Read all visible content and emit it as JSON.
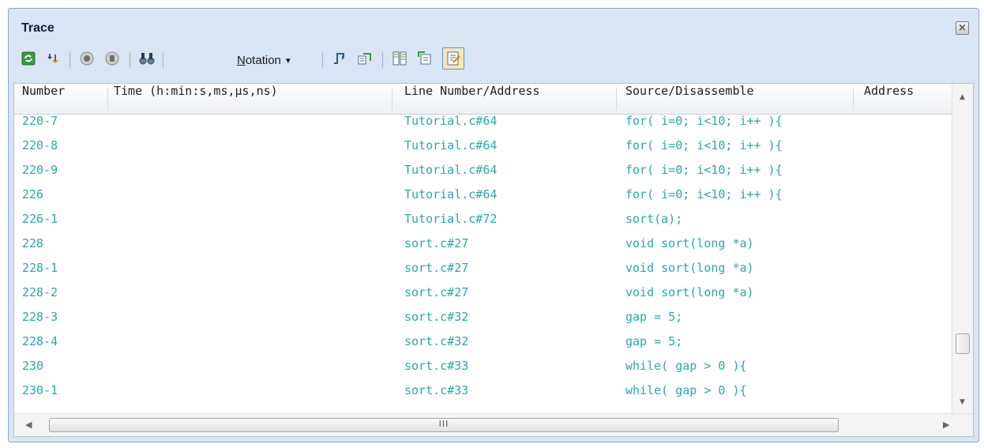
{
  "window": {
    "title": "Trace",
    "close_icon": "close-icon"
  },
  "toolbar": {
    "notation_label": "Notation",
    "notation_mnemonic": "N",
    "notation_rest": "otation",
    "icons": [
      "refresh-icon",
      "step-filter-icon",
      "record-start-icon",
      "record-stop-icon",
      "find-icon",
      "go-to-source-icon",
      "go-to-disassemble-icon",
      "mixed-display-icon",
      "link-to-source-icon",
      "source-disassemble-toggle-icon"
    ]
  },
  "table": {
    "columns": [
      "Number",
      "Time (h:min:s,ms,µs,ns)",
      "Line Number/Address",
      "Source/Disassemble",
      "Address"
    ],
    "rows": [
      {
        "number": "220-7",
        "time": "",
        "line": "Tutorial.c#64",
        "source": "for( i=0; i<10; i++ ){"
      },
      {
        "number": "220-8",
        "time": "",
        "line": "Tutorial.c#64",
        "source": "for( i=0; i<10; i++ ){"
      },
      {
        "number": "220-9",
        "time": "",
        "line": "Tutorial.c#64",
        "source": "for( i=0; i<10; i++ ){"
      },
      {
        "number": "226",
        "time": "",
        "line": "Tutorial.c#64",
        "source": "for( i=0; i<10; i++ ){"
      },
      {
        "number": "226-1",
        "time": "",
        "line": "Tutorial.c#72",
        "source": "sort(a);"
      },
      {
        "number": "228",
        "time": "",
        "line": "sort.c#27",
        "source": "void sort(long *a)"
      },
      {
        "number": "228-1",
        "time": "",
        "line": "sort.c#27",
        "source": "void sort(long *a)"
      },
      {
        "number": "228-2",
        "time": "",
        "line": "sort.c#27",
        "source": "void sort(long *a)"
      },
      {
        "number": "228-3",
        "time": "",
        "line": "sort.c#32",
        "source": "gap = 5;"
      },
      {
        "number": "228-4",
        "time": "",
        "line": "sort.c#32",
        "source": "gap = 5;"
      },
      {
        "number": "230",
        "time": "",
        "line": "sort.c#33",
        "source": "while( gap > 0 ){"
      },
      {
        "number": "230-1",
        "time": "",
        "line": "sort.c#33",
        "source": "while( gap > 0 ){"
      }
    ]
  },
  "scrollbar": {
    "thumb_grip": "III"
  },
  "colors": {
    "row_text": "#2aa8a8",
    "panel_bg": "#d9e5f4"
  }
}
